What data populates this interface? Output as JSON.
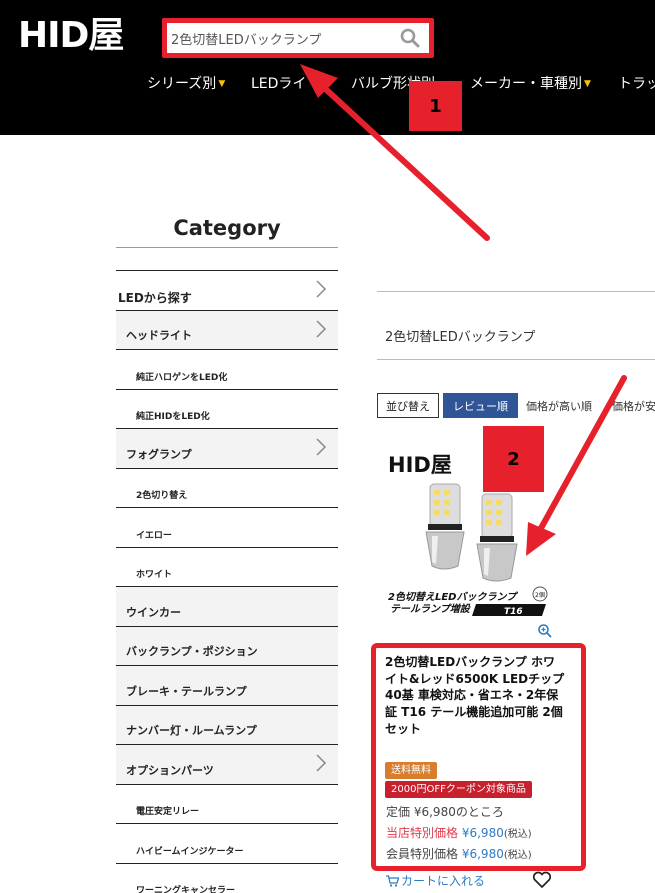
{
  "header": {
    "logo": "HID屋",
    "search": {
      "value": "2色切替LEDバックランプ",
      "placeholder": ""
    },
    "nav": [
      {
        "label": "シリーズ別",
        "caret": "▼"
      },
      {
        "label": "LEDライ",
        "caret": ""
      },
      {
        "label": "バルブ形状別",
        "caret": ""
      },
      {
        "label": "メーカー・車種別",
        "caret": "▼"
      },
      {
        "label": "トラッ",
        "caret": ""
      }
    ]
  },
  "annotations": {
    "badge1": "1",
    "badge2": "2"
  },
  "sidebar": {
    "title": "Category",
    "items": [
      {
        "label": "LEDから探す"
      },
      {
        "label": "ヘッドライト"
      },
      {
        "label": "純正ハロゲンをLED化"
      },
      {
        "label": "純正HIDをLED化"
      },
      {
        "label": "フォグランプ"
      },
      {
        "label": "2色切り替え"
      },
      {
        "label": "イエロー"
      },
      {
        "label": "ホワイト"
      },
      {
        "label": "ウインカー"
      },
      {
        "label": "バックランプ・ポジション"
      },
      {
        "label": "ブレーキ・テールランプ"
      },
      {
        "label": "ナンバー灯・ルームランプ"
      },
      {
        "label": "オプションパーツ"
      },
      {
        "label": "電圧安定リレー"
      },
      {
        "label": "ハイビームインジケーター"
      },
      {
        "label": "ワーニングキャンセラー"
      }
    ]
  },
  "results": {
    "query": "2色切替LEDバックランプ",
    "sort": {
      "label": "並び替え",
      "active": "レビュー順",
      "options": [
        "価格が高い順",
        "価格が安"
      ]
    }
  },
  "product": {
    "image_brand": "HID屋",
    "image_caption": "2色切替えLEDバックランプ",
    "image_caption2": "テールランプ増設",
    "image_model": "T16",
    "image_pack": "2個",
    "title": "2色切替LEDバックランプ ホワイト&レッド6500K LEDチップ40基 車検対応・省エネ・2年保証 T16 テール機能追加可能 2個セット",
    "tags": [
      "送料無料",
      "2000円OFFクーポン対象商品"
    ],
    "list_price_label": "定価",
    "list_price": "¥6,980のところ",
    "store_price_label": "当店特別価格",
    "store_price": "¥6,980",
    "member_price_label": "会員特別価格",
    "member_price": "¥6,980",
    "tax_note": "(税込)",
    "cart_label": "カートに入れる"
  },
  "colors": {
    "accent_red": "#e6212c",
    "sort_active": "#2f5597",
    "price_blue": "#2c7bc4",
    "nav_caret": "#f5c400"
  }
}
